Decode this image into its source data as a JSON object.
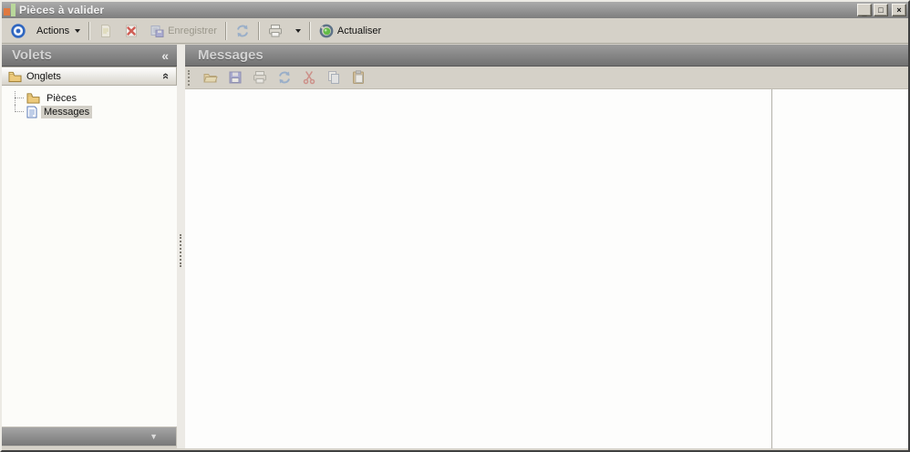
{
  "window": {
    "title": "Pièces à valider"
  },
  "window_controls": {
    "minimize": "_",
    "maximize": "□",
    "close": "×"
  },
  "toolbar": {
    "actions_label": "Actions",
    "save_label": "Enregistrer",
    "refresh_label": "Actualiser"
  },
  "sidebar": {
    "header": "Volets",
    "section_label": "Onglets",
    "tree": [
      {
        "label": "Pièces",
        "icon": "folder"
      },
      {
        "label": "Messages",
        "icon": "document",
        "selected": true
      }
    ]
  },
  "main": {
    "header": "Messages",
    "toolbar_icons": [
      "open-folder",
      "save",
      "print",
      "refresh",
      "cut",
      "copy",
      "paste"
    ]
  },
  "icons": {
    "collapse_left": "«",
    "collapse_up": "«",
    "overflow_down": "▼"
  },
  "colors": {
    "titlebar_gray": "#8e8e8e",
    "panel_header_gray": "#868686",
    "toolbar_bg": "#d5d1c8",
    "selection_bg": "#d2cfc7",
    "accent_blue": "#2f66c0",
    "delete_red": "#cf3a30",
    "refresh_green": "#62bb46"
  }
}
